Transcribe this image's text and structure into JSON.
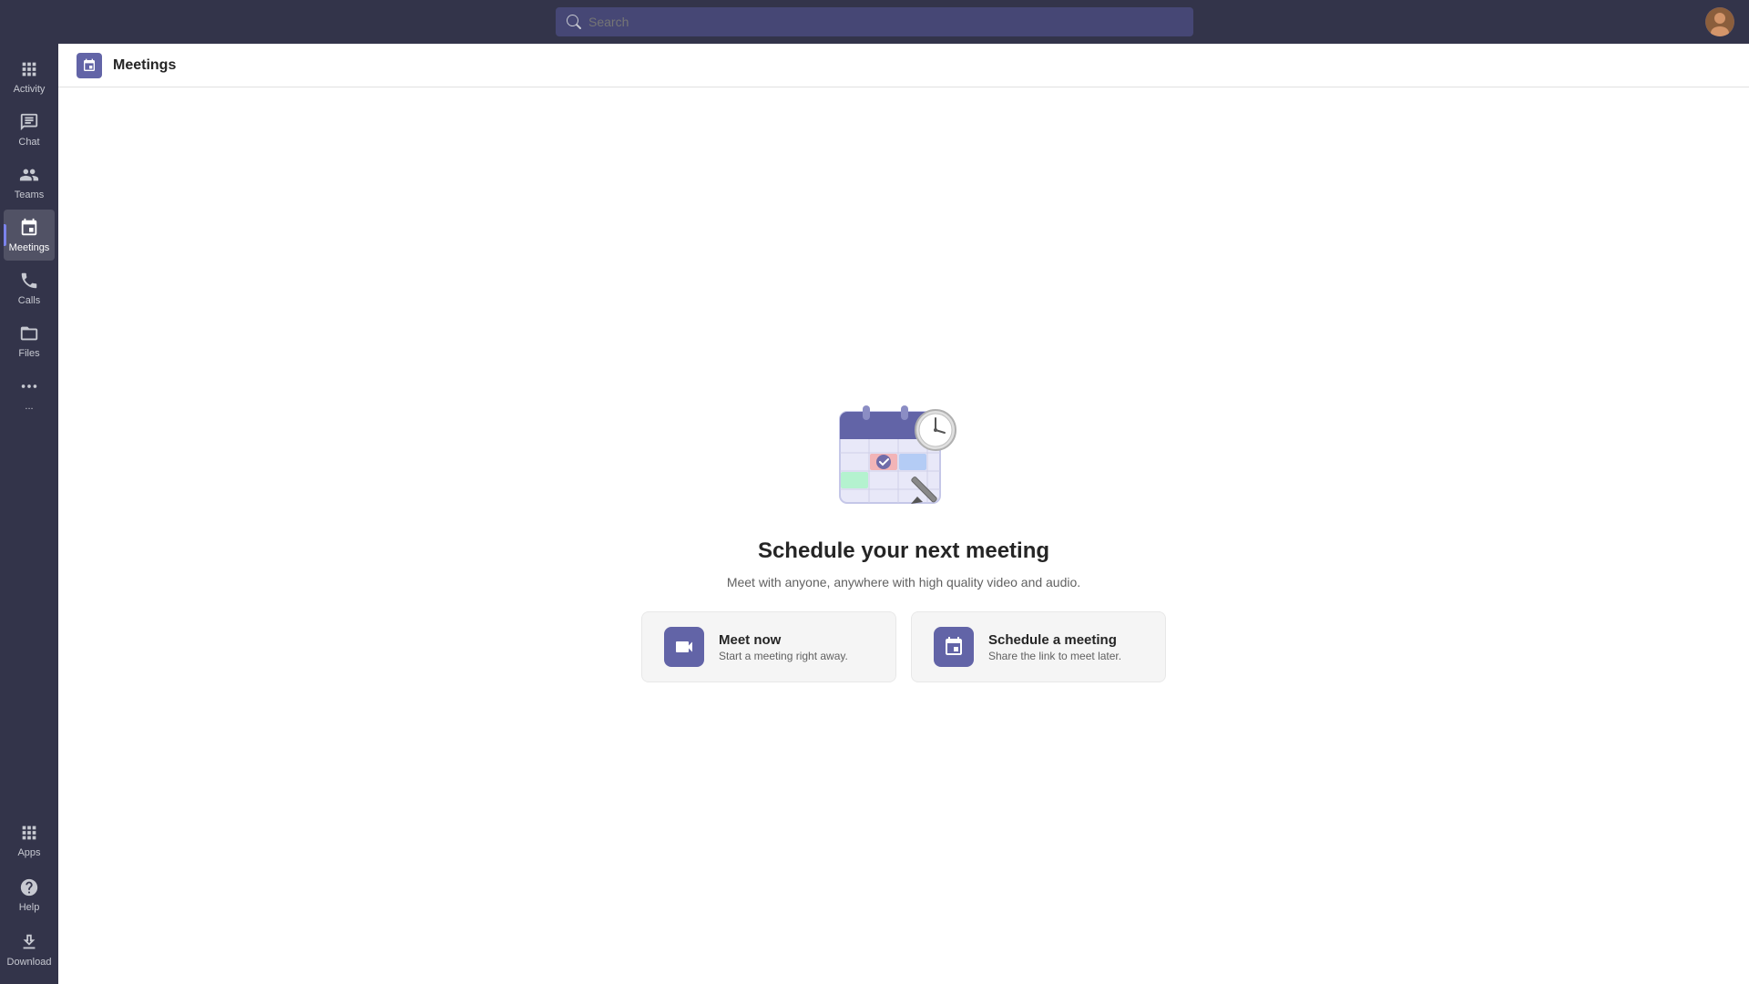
{
  "topbar": {
    "search_placeholder": "Search"
  },
  "sidebar": {
    "items": [
      {
        "id": "activity",
        "label": "Activity",
        "icon": "activity-icon",
        "active": false
      },
      {
        "id": "chat",
        "label": "Chat",
        "icon": "chat-icon",
        "active": false
      },
      {
        "id": "teams",
        "label": "Teams",
        "icon": "teams-icon",
        "active": false
      },
      {
        "id": "meetings",
        "label": "Meetings",
        "icon": "meetings-icon",
        "active": true
      },
      {
        "id": "calls",
        "label": "Calls",
        "icon": "calls-icon",
        "active": false
      },
      {
        "id": "files",
        "label": "Files",
        "icon": "files-icon",
        "active": false
      },
      {
        "id": "more",
        "label": "...",
        "icon": "more-icon",
        "active": false
      }
    ],
    "bottom_items": [
      {
        "id": "apps",
        "label": "Apps",
        "icon": "apps-icon"
      },
      {
        "id": "help",
        "label": "Help",
        "icon": "help-icon"
      },
      {
        "id": "download",
        "label": "Download",
        "icon": "download-icon"
      }
    ]
  },
  "page_header": {
    "title": "Meetings"
  },
  "hero": {
    "title": "Schedule your next meeting",
    "subtitle": "Meet with anyone, anywhere with high quality video and audio."
  },
  "action_cards": [
    {
      "id": "meet-now",
      "title": "Meet now",
      "subtitle": "Start a meeting right away.",
      "icon": "video-icon"
    },
    {
      "id": "schedule-meeting",
      "title": "Schedule a meeting",
      "subtitle": "Share the link to meet later.",
      "icon": "calendar-add-icon"
    }
  ]
}
